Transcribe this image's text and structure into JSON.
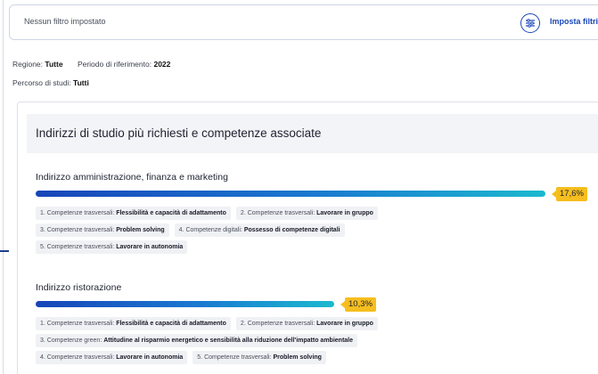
{
  "filter": {
    "status_text": "Nessun filtro impostato",
    "action_label": "Imposta filtri",
    "icon": "sliders-icon"
  },
  "meta": {
    "region_label": "Regione:",
    "region_value": "Tutte",
    "period_label": "Periodo di riferimento:",
    "period_value": "2022",
    "course_label": "Percorso di studi:",
    "course_value": "Tutti"
  },
  "card": {
    "title": "Indirizzi di studio più richiesti e competenze associate",
    "sections": [
      {
        "title": "Indirizzo amministrazione, finanza e marketing",
        "percent_label": "17,6%",
        "percent": 17.6,
        "chips": [
          [
            {
              "prefix": "1. Competenze trasversali: ",
              "value": "Flessibilità e capacità di adattamento"
            },
            {
              "prefix": "2. Competenze trasversali: ",
              "value": "Lavorare in gruppo"
            }
          ],
          [
            {
              "prefix": "3. Competenze trasversali: ",
              "value": "Problem solving"
            },
            {
              "prefix": "4. Competenze digitali: ",
              "value": "Possesso di competenze digitali"
            }
          ],
          [
            {
              "prefix": "5. Competenze trasversali: ",
              "value": "Lavorare in autonomia"
            }
          ]
        ]
      },
      {
        "title": "Indirizzo ristorazione",
        "percent_label": "10,3%",
        "percent": 10.3,
        "chips": [
          [
            {
              "prefix": "1. Competenze trasversali: ",
              "value": "Flessibilità e capacità di adattamento"
            },
            {
              "prefix": "2. Competenze trasversali: ",
              "value": "Lavorare in gruppo"
            }
          ],
          [
            {
              "prefix": "3. Competenze green: ",
              "value": "Attitudine al risparmio energetico e sensibilità alla riduzione dell'impatto ambientale"
            }
          ],
          [
            {
              "prefix": "4. Competenze trasversali: ",
              "value": "Lavorare in autonomia"
            },
            {
              "prefix": "5. Competenze trasversali: ",
              "value": "Problem solving"
            }
          ]
        ]
      }
    ]
  },
  "colors": {
    "accent": "#1a47b8",
    "badge": "#f6be1e",
    "bar_start": "#1845b9",
    "bar_end": "#1cb9cf"
  }
}
